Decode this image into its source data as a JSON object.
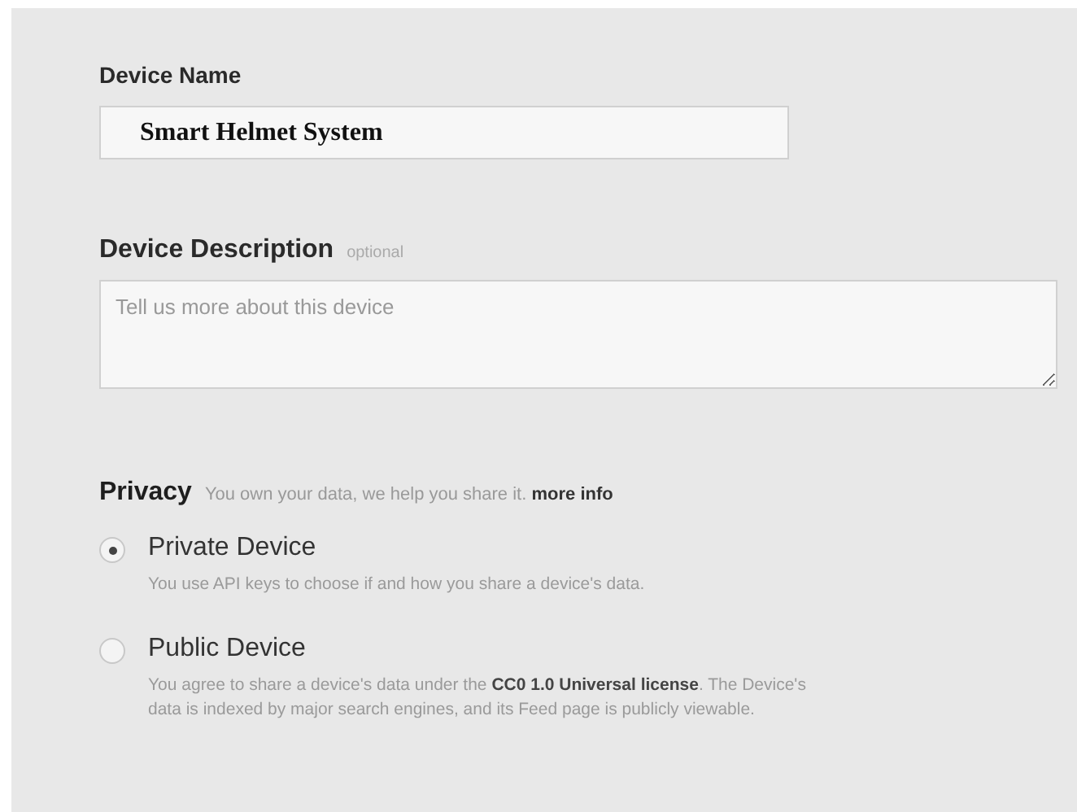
{
  "device_name": {
    "label": "Device Name",
    "value": "Smart Helmet System"
  },
  "device_description": {
    "label": "Device Description",
    "tag": "optional",
    "placeholder": "Tell us more about this device"
  },
  "privacy": {
    "label": "Privacy",
    "hint": "You own your data, we help you share it.",
    "link": "more info",
    "options": [
      {
        "label": "Private Device",
        "selected": true,
        "description": "You use API keys to choose if and how you share a device's data."
      },
      {
        "label": "Public Device",
        "selected": false,
        "description": "You agree to share a device's data under the **CC0 1.0 Universal license**. The Device's data is indexed by major search engines, and its Feed page is publicly viewable."
      }
    ]
  }
}
